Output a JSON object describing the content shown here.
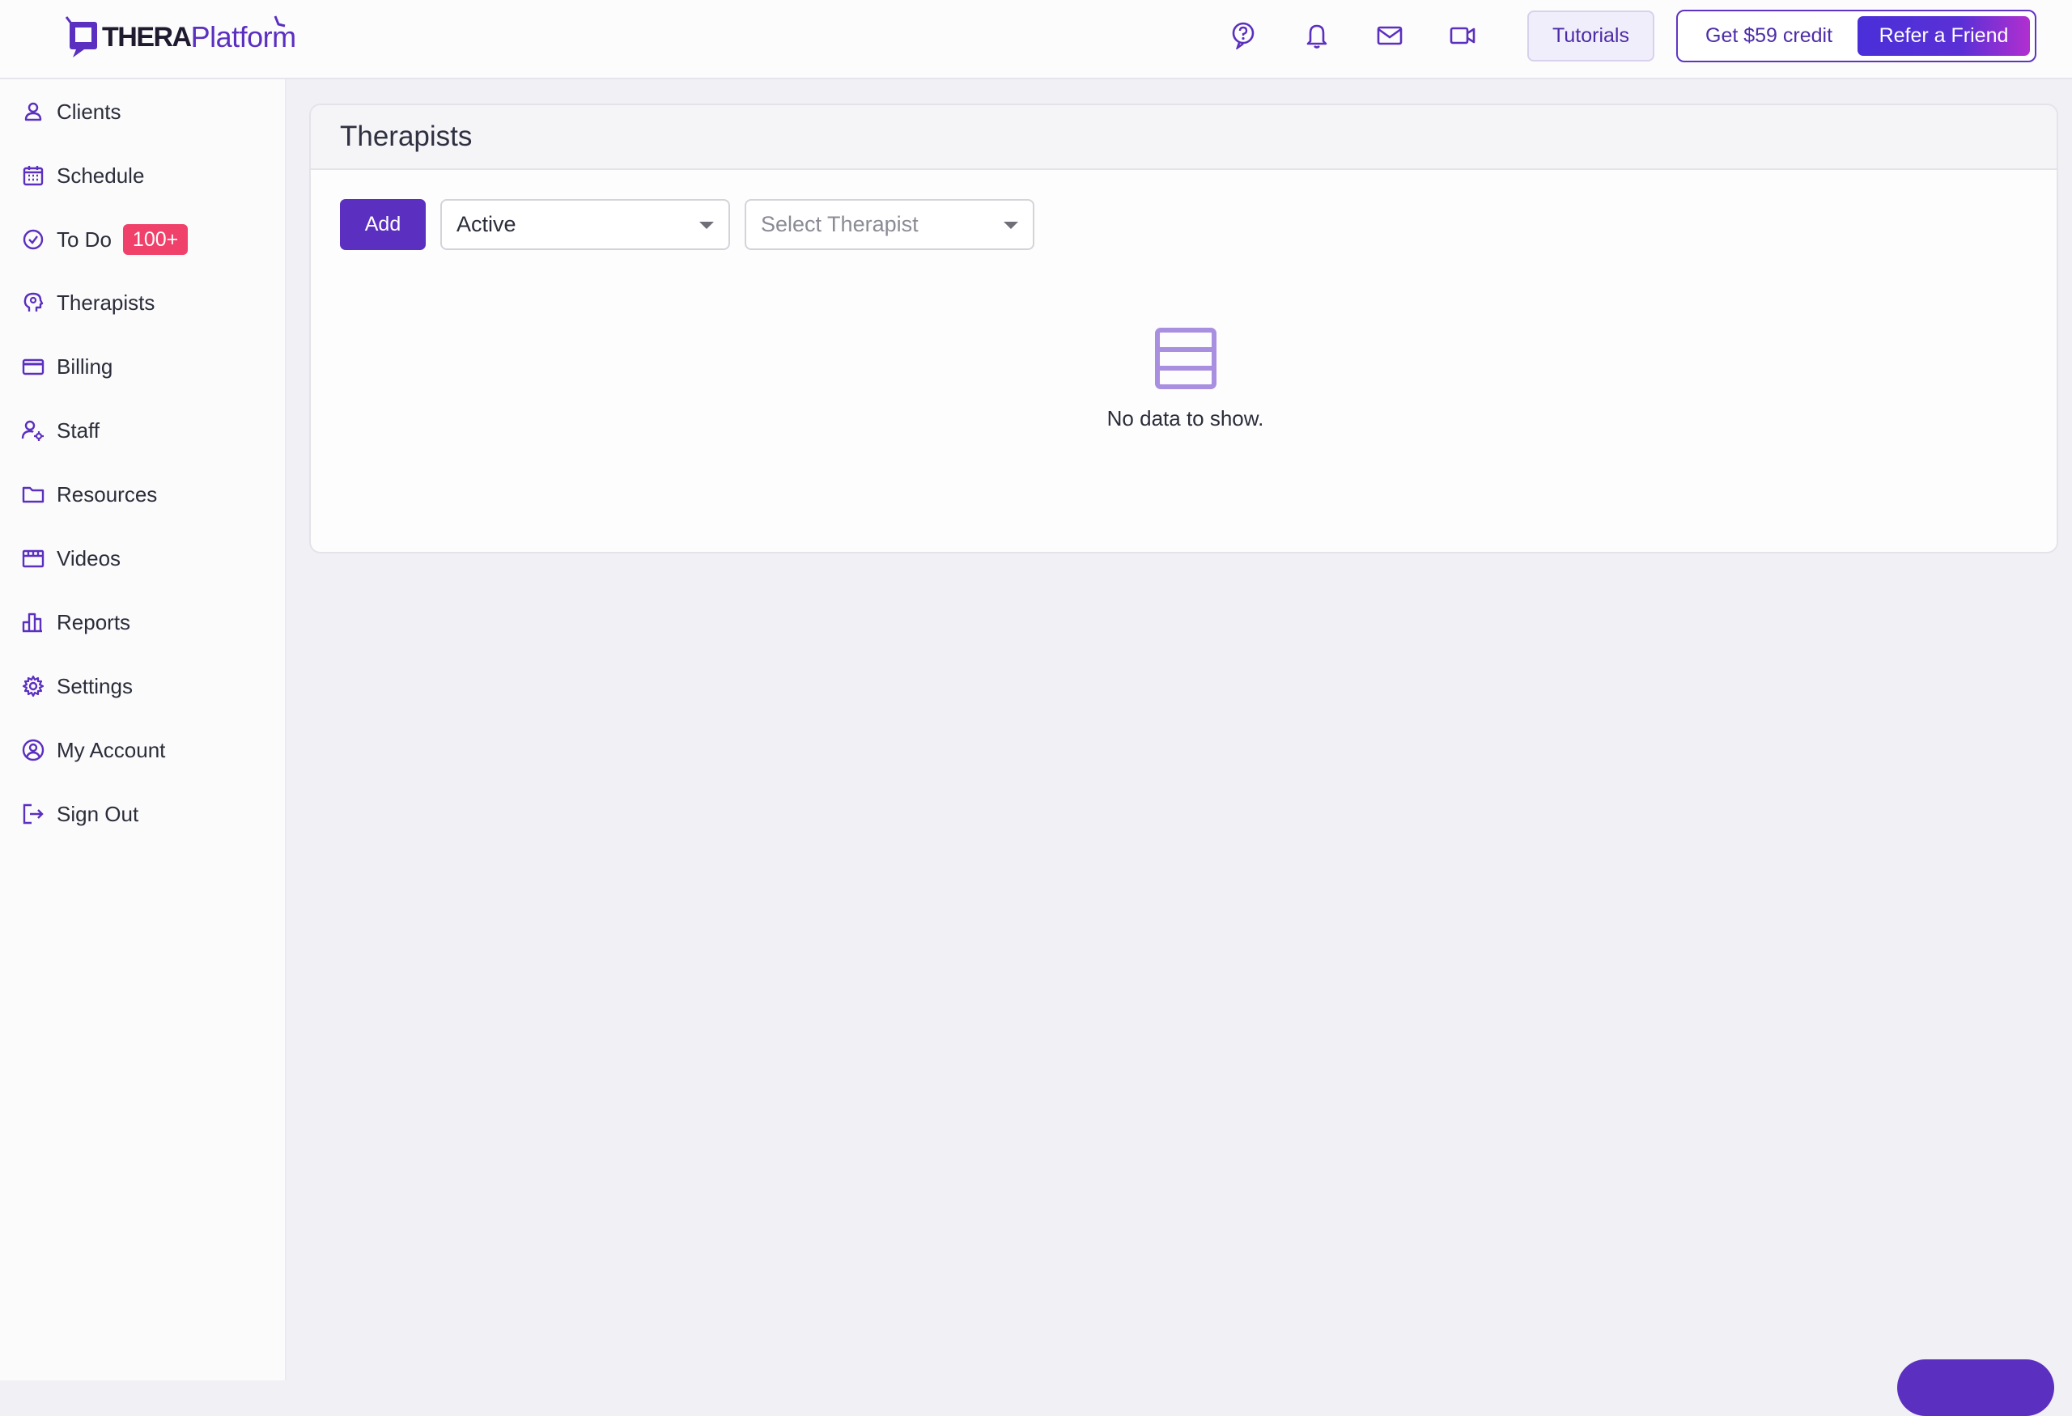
{
  "brand": {
    "logo_bold": "THERA",
    "logo_regular": "Platform"
  },
  "header": {
    "icons": [
      "help-icon",
      "bell-icon",
      "mail-icon",
      "video-icon"
    ],
    "tutorials_label": "Tutorials",
    "credit_label": "Get $59 credit",
    "refer_label": "Refer a Friend"
  },
  "sidebar": {
    "items": [
      {
        "label": "Clients",
        "icon": "user-icon"
      },
      {
        "label": "Schedule",
        "icon": "calendar-icon"
      },
      {
        "label": "To Do",
        "icon": "check-circle-icon",
        "badge": "100+"
      },
      {
        "label": "Therapists",
        "icon": "therapist-head-icon"
      },
      {
        "label": "Billing",
        "icon": "credit-card-icon"
      },
      {
        "label": "Staff",
        "icon": "staff-settings-icon"
      },
      {
        "label": "Resources",
        "icon": "folder-icon"
      },
      {
        "label": "Videos",
        "icon": "film-icon"
      },
      {
        "label": "Reports",
        "icon": "bar-chart-icon"
      },
      {
        "label": "Settings",
        "icon": "gear-icon"
      },
      {
        "label": "My Account",
        "icon": "account-circle-icon"
      },
      {
        "label": "Sign Out",
        "icon": "sign-out-icon"
      }
    ]
  },
  "main": {
    "title": "Therapists",
    "add_label": "Add",
    "status_filter": {
      "value": "Active"
    },
    "therapist_filter": {
      "placeholder": "Select Therapist"
    },
    "empty_message": "No data to show."
  },
  "colors": {
    "brand_purple": "#5b2fbf",
    "badge_red": "#f0416b",
    "page_bg": "#f1f0f5"
  }
}
